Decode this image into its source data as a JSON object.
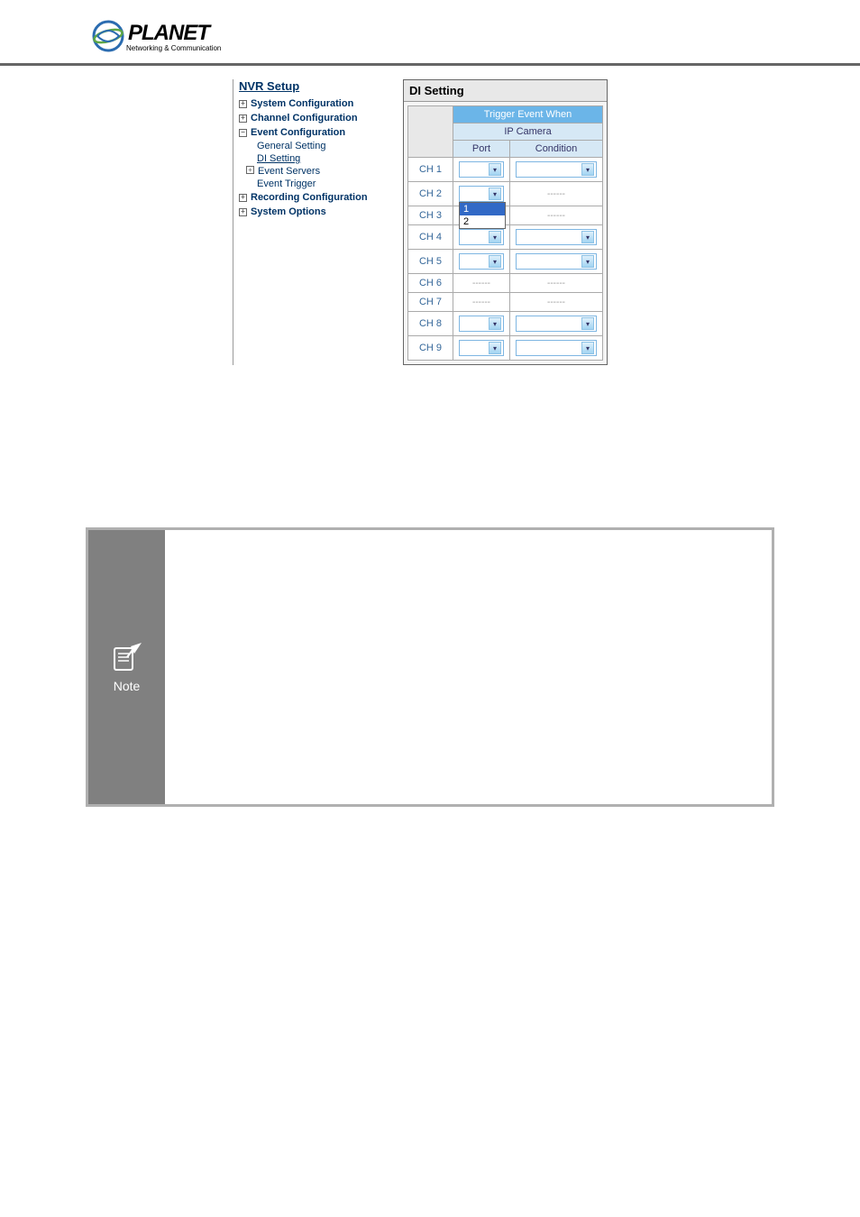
{
  "logo": {
    "brand": "PLANET",
    "tagline": "Networking & Communication"
  },
  "nav": {
    "title": "NVR Setup",
    "items": [
      {
        "label": "System Configuration",
        "exp": "+"
      },
      {
        "label": "Channel Configuration",
        "exp": "+"
      },
      {
        "label": "Event Configuration",
        "exp": "−"
      },
      {
        "label": "Recording Configuration",
        "exp": "+"
      },
      {
        "label": "System Options",
        "exp": "+"
      }
    ],
    "event_sub": {
      "general": "General Setting",
      "di": "DI Setting",
      "servers": "Event Servers",
      "servers_exp": "+",
      "trigger": "Event Trigger"
    }
  },
  "panel": {
    "title": "DI Setting",
    "header_trigger": "Trigger Event When",
    "header_ipcam": "IP Camera",
    "header_port": "Port",
    "header_cond": "Condition",
    "dropdown_opts": [
      "1",
      "2"
    ],
    "rows": [
      {
        "ch": "CH 1",
        "port": "sel",
        "cond": "sel"
      },
      {
        "ch": "CH 2",
        "port": "open",
        "cond": "dash"
      },
      {
        "ch": "CH 3",
        "port": "covered",
        "cond": "dash"
      },
      {
        "ch": "CH 4",
        "port": "sel",
        "cond": "sel"
      },
      {
        "ch": "CH 5",
        "port": "sel",
        "cond": "sel"
      },
      {
        "ch": "CH 6",
        "port": "dash",
        "cond": "dash"
      },
      {
        "ch": "CH 7",
        "port": "dash",
        "cond": "dash"
      },
      {
        "ch": "CH 8",
        "port": "sel",
        "cond": "sel"
      },
      {
        "ch": "CH 9",
        "port": "sel",
        "cond": "sel"
      }
    ],
    "dash": "------"
  },
  "note": {
    "label": "Note"
  }
}
